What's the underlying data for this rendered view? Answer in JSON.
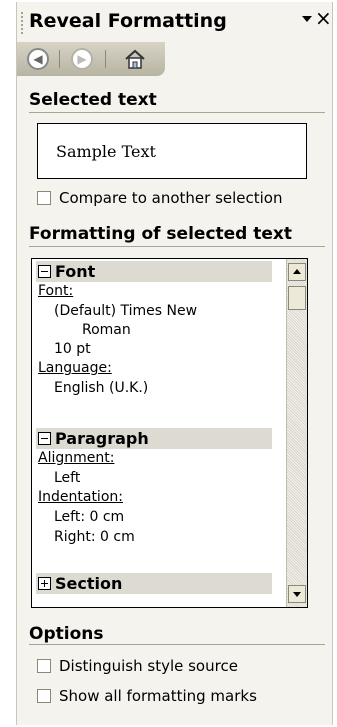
{
  "pane": {
    "title": "Reveal Formatting",
    "close_label": "×",
    "nav": {
      "back_icon": "back-arrow-icon",
      "forward_icon": "forward-arrow-icon",
      "home_icon": "home-icon"
    }
  },
  "selected_text": {
    "heading": "Selected text",
    "sample": "Sample Text",
    "compare_label": "Compare to another selection"
  },
  "formatting": {
    "heading": "Formatting of selected text",
    "groups": {
      "font": {
        "title": "Font",
        "font_label": "Font:",
        "font_value_1": "(Default) Times New",
        "font_value_2": "Roman",
        "size_value": "10 pt",
        "language_label": "Language:",
        "language_value": "English (U.K.)"
      },
      "paragraph": {
        "title": "Paragraph",
        "alignment_label": "Alignment:",
        "alignment_value": "Left",
        "indentation_label": "Indentation:",
        "indent_left": "Left:  0 cm",
        "indent_right": "Right:  0 cm"
      },
      "section": {
        "title": "Section"
      }
    }
  },
  "options": {
    "heading": "Options",
    "distinguish_label": "Distinguish style source",
    "show_marks_label": "Show all formatting marks"
  }
}
